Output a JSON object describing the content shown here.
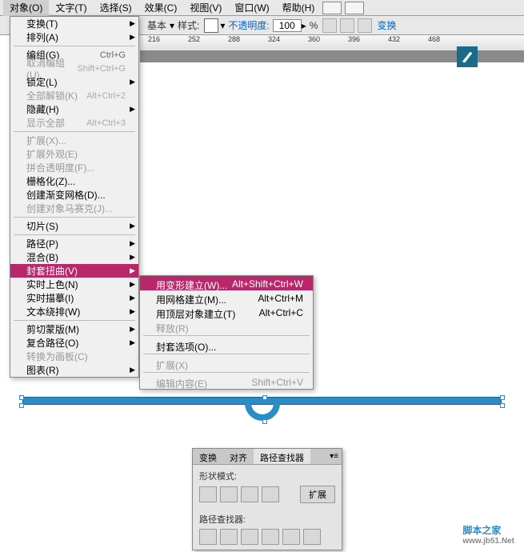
{
  "menubar": {
    "items": [
      {
        "label": "对象(O)",
        "u": "O"
      },
      {
        "label": "文字(T)",
        "u": "T"
      },
      {
        "label": "选择(S)",
        "u": "S"
      },
      {
        "label": "效果(C)",
        "u": "C"
      },
      {
        "label": "视图(V)",
        "u": "V"
      },
      {
        "label": "窗口(W)",
        "u": "W"
      },
      {
        "label": "帮助(H)",
        "u": "H"
      }
    ]
  },
  "toolbar": {
    "basic": "基本",
    "style": "样式:",
    "opacity_label": "不透明度:",
    "opacity_value": "100",
    "percent": "%",
    "transform": "变换"
  },
  "ruler": {
    "ticks": [
      216,
      252,
      288,
      324,
      360,
      396,
      432,
      468
    ]
  },
  "dropdown": {
    "groups": [
      [
        {
          "label": "变换(T)",
          "arrow": true
        },
        {
          "label": "排列(A)",
          "arrow": true
        }
      ],
      [
        {
          "label": "编组(G)",
          "shortcut": "Ctrl+G"
        },
        {
          "label": "取消编组(U)",
          "shortcut": "Shift+Ctrl+G",
          "disabled": true
        },
        {
          "label": "锁定(L)",
          "arrow": true
        },
        {
          "label": "全部解锁(K)",
          "shortcut": "Alt+Ctrl+2",
          "disabled": true
        },
        {
          "label": "隐藏(H)",
          "arrow": true
        },
        {
          "label": "显示全部",
          "shortcut": "Alt+Ctrl+3",
          "disabled": true
        }
      ],
      [
        {
          "label": "扩展(X)...",
          "disabled": true
        },
        {
          "label": "扩展外观(E)",
          "disabled": true
        },
        {
          "label": "拼合透明度(F)...",
          "disabled": true
        },
        {
          "label": "栅格化(Z)..."
        },
        {
          "label": "创建渐变网格(D)..."
        },
        {
          "label": "创建对象马赛克(J)...",
          "disabled": true
        }
      ],
      [
        {
          "label": "切片(S)",
          "arrow": true
        }
      ],
      [
        {
          "label": "路径(P)",
          "arrow": true
        },
        {
          "label": "混合(B)",
          "arrow": true
        },
        {
          "label": "封套扭曲(V)",
          "arrow": true,
          "highlight": true
        },
        {
          "label": "实时上色(N)",
          "arrow": true
        },
        {
          "label": "实时描摹(I)",
          "arrow": true
        },
        {
          "label": "文本绕排(W)",
          "arrow": true
        }
      ],
      [
        {
          "label": "剪切蒙版(M)",
          "arrow": true
        },
        {
          "label": "复合路径(O)",
          "arrow": true
        },
        {
          "label": "转换为画板(C)",
          "disabled": true
        },
        {
          "label": "图表(R)",
          "arrow": true
        }
      ]
    ]
  },
  "submenu": {
    "groups": [
      [
        {
          "label": "用变形建立(W)...",
          "shortcut": "Alt+Shift+Ctrl+W",
          "highlight": true
        },
        {
          "label": "用网格建立(M)...",
          "shortcut": "Alt+Ctrl+M"
        },
        {
          "label": "用顶层对象建立(T)",
          "shortcut": "Alt+Ctrl+C"
        },
        {
          "label": "释放(R)",
          "disabled": true
        }
      ],
      [
        {
          "label": "封套选项(O)..."
        }
      ],
      [
        {
          "label": "扩展(X)",
          "disabled": true
        }
      ],
      [
        {
          "label": "编辑内容(E)",
          "shortcut": "Shift+Ctrl+V",
          "disabled": true
        }
      ]
    ]
  },
  "panel": {
    "tabs": [
      "变换",
      "对齐",
      "路径查找器"
    ],
    "active_tab": 2,
    "shape_mode": "形状模式:",
    "expand": "扩展",
    "pathfinder": "路径查找器:"
  },
  "watermark": {
    "main": "脚本之家",
    "sub": "www.jb51.Net"
  }
}
